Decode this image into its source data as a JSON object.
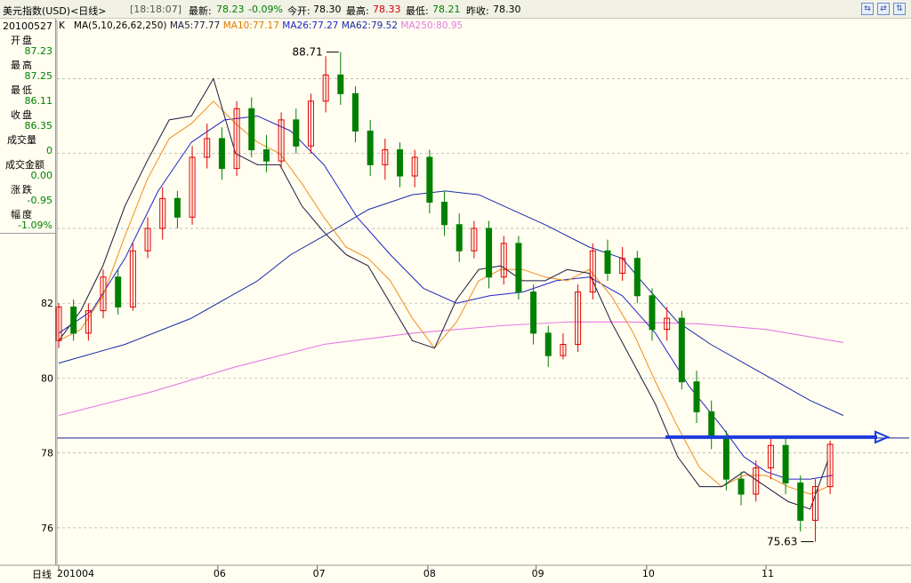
{
  "header": {
    "title": "美元指数(USD)<日线>",
    "time": "[18:18:07]",
    "latest_label": "最新:",
    "latest_value": "78.23",
    "change": "-0.09%",
    "open_label": "今开:",
    "open_value": "78.30",
    "high_label": "最高:",
    "high_value": "78.33",
    "low_label": "最低:",
    "low_value": "78.21",
    "prev_label": "昨收:",
    "prev_value": "78.30"
  },
  "ma_legend": {
    "k": "K",
    "params": "MA(5,10,26,62,250)",
    "ma5": "MA5:77.77",
    "ma10": "MA10:77.17",
    "ma26": "MA26:77.27",
    "ma62": "MA62:79.52",
    "ma250": "MA250:80.95"
  },
  "colors": {
    "up": "#e00000",
    "down": "#008000",
    "ma5": "#1a1a40",
    "ma10": "#f08c1e",
    "ma26": "#2323c8",
    "ma62": "#1a2aa8",
    "ma250": "#e678e6",
    "hline": "#2020a0",
    "arrow": "#1c3cdc"
  },
  "info_panel": {
    "date": "20100527",
    "open_label": "开盘",
    "open_value": "87.23",
    "high_label": "最高",
    "high_value": "87.25",
    "low_label": "最低",
    "low_value": "86.11",
    "close_label": "收盘",
    "close_value": "86.35",
    "volume_label": "成交量",
    "volume_value": "0",
    "amount_label": "成交金额",
    "amount_value": "0.00",
    "chg_label": "涨跌",
    "chg_value": "-0.95",
    "pct_label": "幅度",
    "pct_value": "-1.09%"
  },
  "bottom_bar": {
    "period": "日线"
  },
  "chart_data": {
    "type": "candlestick",
    "ylim": [
      75.0,
      89.2
    ],
    "y_ticks": [
      76,
      78,
      80,
      82
    ],
    "x_tick_labels": [
      "201004",
      "06",
      "07",
      "08",
      "09",
      "10",
      "11"
    ],
    "annotations": [
      {
        "text": "88.71",
        "value": 88.71,
        "kind": "max"
      },
      {
        "text": "75.63",
        "value": 75.63,
        "kind": "min"
      }
    ],
    "horizontal_line_value": 78.4,
    "ma_series": {
      "ma250": [
        [
          0,
          79.0
        ],
        [
          40,
          79.6
        ],
        [
          80,
          80.3
        ],
        [
          120,
          80.9
        ],
        [
          160,
          81.2
        ],
        [
          200,
          81.4
        ],
        [
          230,
          81.5
        ],
        [
          260,
          81.5
        ],
        [
          290,
          81.45
        ],
        [
          320,
          81.3
        ],
        [
          340,
          81.1
        ],
        [
          355,
          80.95
        ]
      ],
      "ma62": [
        [
          0,
          80.4
        ],
        [
          30,
          80.9
        ],
        [
          60,
          81.6
        ],
        [
          90,
          82.6
        ],
        [
          105,
          83.3
        ],
        [
          120,
          83.8
        ],
        [
          140,
          84.5
        ],
        [
          160,
          84.9
        ],
        [
          175,
          85.0
        ],
        [
          190,
          84.9
        ],
        [
          205,
          84.5
        ],
        [
          220,
          84.1
        ],
        [
          240,
          83.5
        ],
        [
          255,
          83.2
        ],
        [
          265,
          82.5
        ],
        [
          280,
          81.5
        ],
        [
          295,
          80.9
        ],
        [
          310,
          80.4
        ],
        [
          325,
          79.9
        ],
        [
          340,
          79.4
        ],
        [
          355,
          79.0
        ]
      ],
      "ma26": [
        [
          0,
          81.2
        ],
        [
          15,
          81.8
        ],
        [
          30,
          83.2
        ],
        [
          45,
          85.0
        ],
        [
          60,
          86.3
        ],
        [
          75,
          86.9
        ],
        [
          90,
          87.0
        ],
        [
          105,
          86.6
        ],
        [
          120,
          85.7
        ],
        [
          135,
          84.3
        ],
        [
          150,
          83.3
        ],
        [
          165,
          82.4
        ],
        [
          180,
          82.0
        ],
        [
          195,
          82.2
        ],
        [
          210,
          82.3
        ],
        [
          225,
          82.6
        ],
        [
          240,
          82.7
        ],
        [
          255,
          82.2
        ],
        [
          270,
          81.2
        ],
        [
          285,
          79.8
        ],
        [
          300,
          78.7
        ],
        [
          310,
          77.9
        ],
        [
          320,
          77.5
        ],
        [
          330,
          77.3
        ],
        [
          340,
          77.3
        ],
        [
          350,
          77.4
        ]
      ],
      "ma10": [
        [
          0,
          81.0
        ],
        [
          10,
          81.3
        ],
        [
          20,
          82.2
        ],
        [
          30,
          83.8
        ],
        [
          40,
          85.3
        ],
        [
          50,
          86.4
        ],
        [
          60,
          86.8
        ],
        [
          70,
          87.4
        ],
        [
          80,
          86.8
        ],
        [
          90,
          86.3
        ],
        [
          100,
          86.0
        ],
        [
          110,
          85.2
        ],
        [
          120,
          84.3
        ],
        [
          130,
          83.5
        ],
        [
          140,
          83.2
        ],
        [
          150,
          82.6
        ],
        [
          160,
          81.6
        ],
        [
          170,
          80.8
        ],
        [
          180,
          81.5
        ],
        [
          190,
          82.6
        ],
        [
          200,
          82.9
        ],
        [
          210,
          82.9
        ],
        [
          220,
          82.7
        ],
        [
          230,
          82.6
        ],
        [
          240,
          82.9
        ],
        [
          250,
          82.2
        ],
        [
          260,
          81.2
        ],
        [
          270,
          79.9
        ],
        [
          280,
          78.7
        ],
        [
          290,
          77.6
        ],
        [
          300,
          77.1
        ],
        [
          310,
          77.4
        ],
        [
          320,
          77.4
        ],
        [
          330,
          77.1
        ],
        [
          340,
          76.9
        ],
        [
          348,
          77.1
        ]
      ],
      "ma5": [
        [
          0,
          81.0
        ],
        [
          10,
          81.8
        ],
        [
          20,
          83.0
        ],
        [
          30,
          84.6
        ],
        [
          40,
          85.8
        ],
        [
          50,
          86.9
        ],
        [
          60,
          87.0
        ],
        [
          70,
          88.0
        ],
        [
          80,
          86.0
        ],
        [
          90,
          85.7
        ],
        [
          100,
          85.7
        ],
        [
          110,
          84.6
        ],
        [
          120,
          83.9
        ],
        [
          130,
          83.3
        ],
        [
          140,
          83.0
        ],
        [
          150,
          82.0
        ],
        [
          160,
          81.0
        ],
        [
          170,
          80.8
        ],
        [
          180,
          82.1
        ],
        [
          190,
          82.9
        ],
        [
          200,
          83.0
        ],
        [
          210,
          82.6
        ],
        [
          220,
          82.6
        ],
        [
          230,
          82.9
        ],
        [
          240,
          82.8
        ],
        [
          250,
          81.5
        ],
        [
          260,
          80.4
        ],
        [
          270,
          79.3
        ],
        [
          280,
          77.9
        ],
        [
          290,
          77.1
        ],
        [
          300,
          77.1
        ],
        [
          310,
          77.5
        ],
        [
          320,
          77.1
        ],
        [
          330,
          76.7
        ],
        [
          340,
          76.5
        ],
        [
          348,
          77.8
        ]
      ]
    },
    "candles": [
      [
        81.0,
        81.9,
        82.0,
        80.8
      ],
      [
        81.9,
        81.2,
        82.1,
        81.0
      ],
      [
        81.2,
        81.8,
        82.0,
        81.0
      ],
      [
        81.8,
        82.7,
        82.9,
        81.6
      ],
      [
        82.7,
        81.9,
        82.9,
        81.7
      ],
      [
        81.9,
        83.4,
        83.6,
        81.8
      ],
      [
        83.4,
        84.0,
        84.3,
        83.2
      ],
      [
        84.0,
        84.8,
        85.1,
        83.7
      ],
      [
        84.8,
        84.3,
        85.0,
        84.0
      ],
      [
        84.3,
        85.9,
        86.2,
        84.1
      ],
      [
        85.9,
        86.4,
        86.8,
        85.6
      ],
      [
        86.4,
        85.6,
        86.7,
        85.3
      ],
      [
        85.6,
        87.2,
        87.4,
        85.4
      ],
      [
        87.2,
        86.1,
        87.5,
        85.9
      ],
      [
        86.1,
        85.8,
        86.5,
        85.5
      ],
      [
        85.8,
        86.9,
        87.1,
        85.6
      ],
      [
        86.9,
        86.2,
        87.2,
        86.0
      ],
      [
        86.2,
        87.4,
        87.6,
        86.0
      ],
      [
        87.4,
        88.1,
        88.6,
        87.1
      ],
      [
        88.1,
        87.6,
        88.71,
        87.3
      ],
      [
        87.6,
        86.6,
        87.8,
        86.3
      ],
      [
        86.6,
        85.7,
        86.9,
        85.4
      ],
      [
        85.7,
        86.1,
        86.4,
        85.3
      ],
      [
        86.1,
        85.4,
        86.3,
        85.1
      ],
      [
        85.4,
        85.9,
        86.1,
        85.1
      ],
      [
        85.9,
        84.7,
        86.1,
        84.4
      ],
      [
        84.7,
        84.1,
        85.0,
        83.8
      ],
      [
        84.1,
        83.4,
        84.4,
        83.1
      ],
      [
        83.4,
        84.0,
        84.2,
        83.2
      ],
      [
        84.0,
        82.7,
        84.2,
        82.4
      ],
      [
        82.7,
        83.6,
        83.8,
        82.5
      ],
      [
        83.6,
        82.3,
        83.8,
        82.1
      ],
      [
        82.3,
        81.2,
        82.5,
        80.9
      ],
      [
        81.2,
        80.6,
        81.4,
        80.3
      ],
      [
        80.6,
        80.9,
        81.2,
        80.5
      ],
      [
        80.9,
        82.3,
        82.5,
        80.7
      ],
      [
        82.3,
        83.4,
        83.6,
        82.1
      ],
      [
        83.4,
        82.8,
        83.7,
        82.6
      ],
      [
        82.8,
        83.2,
        83.5,
        82.6
      ],
      [
        83.2,
        82.2,
        83.4,
        82.0
      ],
      [
        82.2,
        81.3,
        82.4,
        81.0
      ],
      [
        81.3,
        81.6,
        81.9,
        81.0
      ],
      [
        81.6,
        79.9,
        81.8,
        79.7
      ],
      [
        79.9,
        79.1,
        80.2,
        78.8
      ],
      [
        79.1,
        78.4,
        79.4,
        78.1
      ],
      [
        78.4,
        77.3,
        78.6,
        77.0
      ],
      [
        77.3,
        76.9,
        77.5,
        76.6
      ],
      [
        76.9,
        77.6,
        77.8,
        76.7
      ],
      [
        77.6,
        78.2,
        78.4,
        77.3
      ],
      [
        78.2,
        77.2,
        78.4,
        76.9
      ],
      [
        77.2,
        76.2,
        77.4,
        75.9
      ],
      [
        76.2,
        77.1,
        77.3,
        75.63
      ],
      [
        77.1,
        78.23,
        78.33,
        76.9
      ]
    ]
  }
}
